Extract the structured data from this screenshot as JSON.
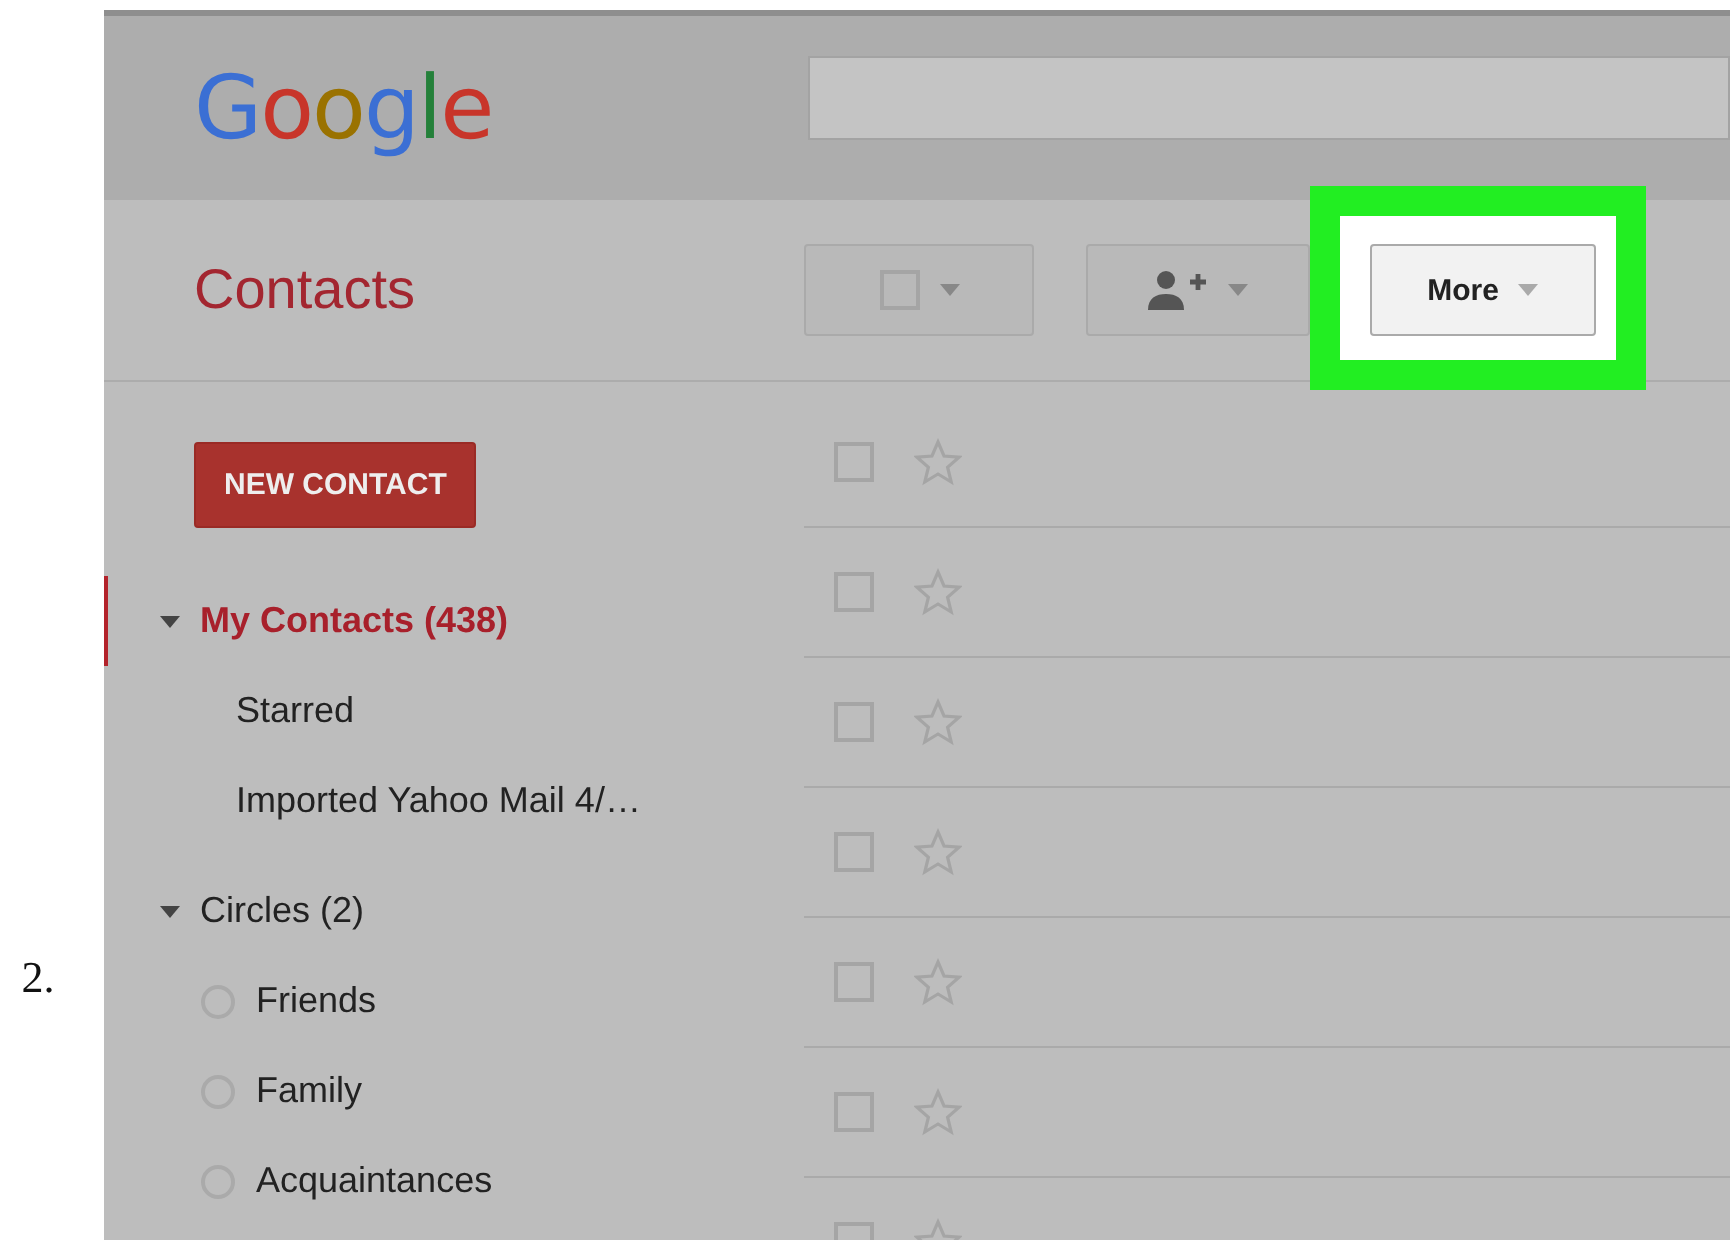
{
  "step_number": "2.",
  "header": {
    "logo": "Google"
  },
  "toolbar": {
    "title": "Contacts",
    "buttons": [
      {
        "kind": "select",
        "highlighted": false
      },
      {
        "kind": "add-person",
        "highlighted": false
      },
      {
        "kind": "menu",
        "label": "More",
        "highlighted": true
      }
    ]
  },
  "sidebar": {
    "new_contact": "NEW CONTACT",
    "groups": [
      {
        "label": "My Contacts (438)",
        "expanded": true,
        "selected": true,
        "children": [
          {
            "label": "Starred",
            "kind": "plain",
            "selected": false
          },
          {
            "label": "Imported Yahoo Mail 4/…",
            "kind": "plain",
            "selected": false
          }
        ]
      },
      {
        "label": "Circles (2)",
        "expanded": true,
        "selected": false,
        "children": [
          {
            "label": "Friends",
            "kind": "circle",
            "selected": false
          },
          {
            "label": "Family",
            "kind": "circle",
            "selected": false
          },
          {
            "label": "Acquaintances",
            "kind": "circle",
            "selected": false
          }
        ]
      }
    ]
  },
  "contacts": [
    {
      "checked": false,
      "starred": false
    },
    {
      "checked": false,
      "starred": false
    },
    {
      "checked": false,
      "starred": false
    },
    {
      "checked": false,
      "starred": false
    },
    {
      "checked": false,
      "starred": false
    },
    {
      "checked": false,
      "starred": false
    },
    {
      "checked": false,
      "starred": false
    }
  ]
}
